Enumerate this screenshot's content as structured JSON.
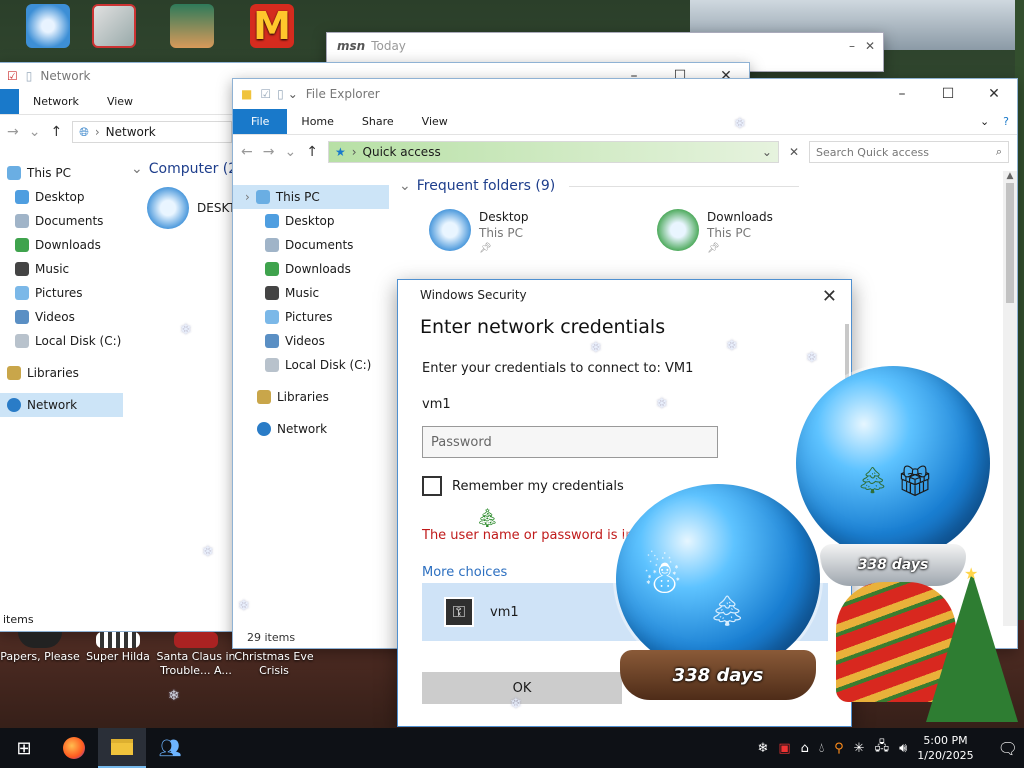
{
  "desktop": {
    "top_icons": [
      {
        "name": "old-mac-icon"
      },
      {
        "name": "safe-icon"
      },
      {
        "name": "game-character-icon"
      },
      {
        "name": "mcdonalds-icon"
      }
    ],
    "bottom_icons": [
      {
        "label": "Papers, Please"
      },
      {
        "label": "Super Hilda"
      },
      {
        "label": "Santa Claus in Trouble... A..."
      },
      {
        "label": "Christmas Eve Crisis"
      }
    ]
  },
  "msn_window": {
    "logo": "msn",
    "title": "Today"
  },
  "back_explorer": {
    "title": "Network",
    "ribbon": [
      "Network",
      "View"
    ],
    "address": "Network",
    "nav": [
      "This PC",
      "Desktop",
      "Documents",
      "Downloads",
      "Music",
      "Pictures",
      "Videos",
      "Local Disk (C:)",
      "Libraries",
      "Network"
    ],
    "group_header": "Computer (2)",
    "item": "DESKTO",
    "status": "items"
  },
  "front_explorer": {
    "title": "File Explorer",
    "ribbon": {
      "file": "File",
      "home": "Home",
      "share": "Share",
      "view": "View"
    },
    "address": "Quick access",
    "search_placeholder": "Search Quick access",
    "nav": [
      "This PC",
      "Desktop",
      "Documents",
      "Downloads",
      "Music",
      "Pictures",
      "Videos",
      "Local Disk (C:)",
      "Libraries",
      "Network"
    ],
    "section_header": "Frequent folders (9)",
    "folders": [
      {
        "name": "Desktop",
        "location": "This PC"
      },
      {
        "name": "Downloads",
        "location": "This PC"
      }
    ],
    "status": "29 items"
  },
  "dialog": {
    "window_title": "Windows Security",
    "heading": "Enter network credentials",
    "connect_text": "Enter your credentials to connect to: VM1",
    "username": "vm1",
    "password_placeholder": "Password",
    "remember_label": "Remember my credentials",
    "remember_checked": false,
    "error_text": "The user name or password is inco",
    "more_choices": "More choices",
    "account_name": "vm1",
    "ok_label": "OK",
    "colors": {
      "error": "#c01a1a",
      "link": "#2c6fc0",
      "account_bg": "#cfe3f7"
    }
  },
  "globes": {
    "small_days": "338 days",
    "large_days": "338 days"
  },
  "taskbar": {
    "apps": [
      "start-icon",
      "firefox-icon",
      "file-explorer-icon",
      "people-icon"
    ],
    "time": "5:00 PM",
    "date": "1/20/2025"
  }
}
